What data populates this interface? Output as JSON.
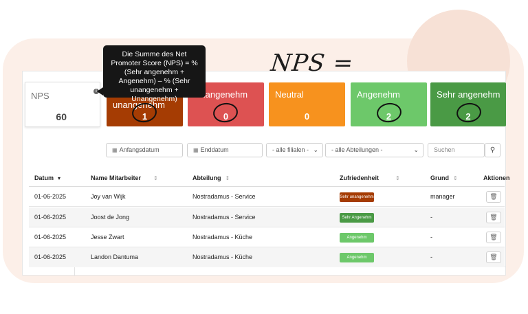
{
  "annotation": {
    "text": "NPS ="
  },
  "tooltip": {
    "text": "Die Summe des Net Promoter Score (NPS) = % (Sehr angenehm + Angenehm) – % (Sehr unangenehm + Unangenehm)"
  },
  "cards": {
    "nps": {
      "label": "NPS",
      "value": "60"
    },
    "sehr_unangenehm": {
      "label": "Sehr unangenehm",
      "value": "1",
      "color": "#a53c03"
    },
    "unangenehm": {
      "label": "Unangenehm",
      "value": "0",
      "color": "#dd5252"
    },
    "neutral": {
      "label": "Neutral",
      "value": "0",
      "color": "#f7921e"
    },
    "angenehm": {
      "label": "Angenehm",
      "value": "2",
      "color": "#6dc86a"
    },
    "sehr_angenehm": {
      "label": "Sehr angenehm",
      "value": "2",
      "color": "#4a9a45"
    }
  },
  "filters": {
    "start_date": "Anfangsdatum",
    "end_date": "Enddatum",
    "filialen": "- alle filialen -",
    "abteilungen": "- alle Abteilungen -",
    "search_placeholder": "Suchen"
  },
  "table": {
    "headers": {
      "datum": "Datum",
      "mitarbeiter": "Name Mitarbeiter",
      "abteilung": "Abteilung",
      "zufriedenheit": "Zufriedenheit",
      "grund": "Grund",
      "aktionen": "Aktionen"
    },
    "rows": [
      {
        "datum": "01-06-2025",
        "name": "Joy van Wijk",
        "abteilung": "Nostradamus -  Service",
        "zufriedenheit": "Sehr unangenehm",
        "badge_color": "#a53c03",
        "grund": "manager"
      },
      {
        "datum": "01-06-2025",
        "name": "Joost de Jong",
        "abteilung": "Nostradamus -  Service",
        "zufriedenheit": "Sehr Angenehm",
        "badge_color": "#4a9a45",
        "grund": "-"
      },
      {
        "datum": "01-06-2025",
        "name": "Jesse Zwart",
        "abteilung": "Nostradamus -  Küche",
        "zufriedenheit": "Angenehm",
        "badge_color": "#6dc86a",
        "grund": "-"
      },
      {
        "datum": "01-06-2025",
        "name": "Landon Dantuma",
        "abteilung": "Nostradamus -  Küche",
        "zufriedenheit": "Angenehm",
        "badge_color": "#6dc86a",
        "grund": "-"
      }
    ]
  }
}
